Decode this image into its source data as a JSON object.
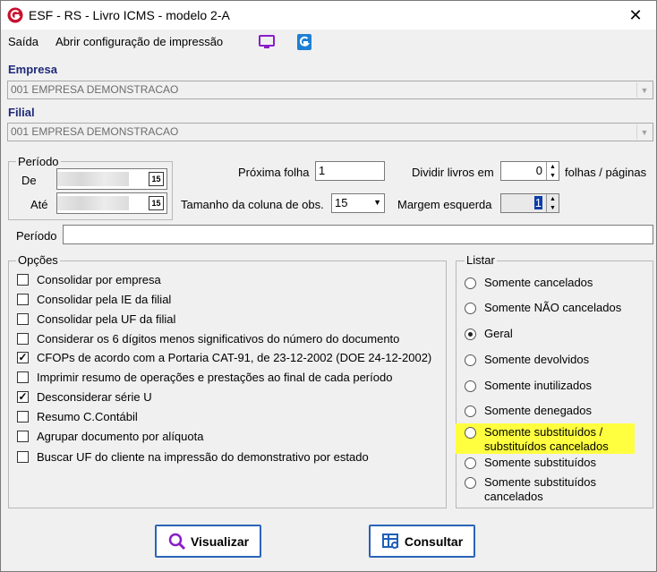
{
  "window": {
    "title": "ESF - RS - Livro ICMS - modelo 2-A",
    "close_glyph": "✕"
  },
  "menu": {
    "exit": "Saída",
    "open_print_config": "Abrir configuração de impressão"
  },
  "company": {
    "label": "Empresa",
    "value": "001 EMPRESA DEMONSTRACAO"
  },
  "branch": {
    "label": "Filial",
    "value": "001 EMPRESA DEMONSTRACAO"
  },
  "period": {
    "group_title": "Período",
    "from_label": "De",
    "to_label": "Até",
    "calendar_glyph": "15"
  },
  "fields": {
    "next_sheet_label": "Próxima folha",
    "next_sheet_value": "1",
    "split_books_label": "Dividir livros em",
    "split_books_value": "0",
    "split_books_suffix": "folhas / páginas",
    "obs_col_label": "Tamanho da coluna de obs.",
    "obs_col_value": "15",
    "left_margin_label": "Margem esquerda",
    "left_margin_value": "1",
    "period_text_label": "Período",
    "period_text_value": ""
  },
  "options": {
    "group_title": "Opções",
    "items": [
      {
        "label": "Consolidar por empresa",
        "checked": false
      },
      {
        "label": "Consolidar pela IE da filial",
        "checked": false
      },
      {
        "label": "Consolidar pela UF da filial",
        "checked": false
      },
      {
        "label": "Considerar os 6 dígitos menos significativos do número do documento",
        "checked": false
      },
      {
        "label": "CFOPs de acordo com a Portaria CAT-91, de 23-12-2002 (DOE 24-12-2002)",
        "checked": true
      },
      {
        "label": "Imprimir resumo de operações e prestações ao final de cada período",
        "checked": false
      },
      {
        "label": "Desconsiderar série U",
        "checked": true
      },
      {
        "label": "Resumo C.Contábil",
        "checked": false
      },
      {
        "label": "Agrupar documento por alíquota",
        "checked": false
      },
      {
        "label": "Buscar UF do cliente na impressão do demonstrativo por estado",
        "checked": false
      }
    ]
  },
  "list": {
    "group_title": "Listar",
    "items": [
      {
        "line1": "Somente cancelados",
        "line2": "",
        "selected": false
      },
      {
        "line1": "Somente NÃO cancelados",
        "line2": "",
        "selected": false
      },
      {
        "line1": "Geral",
        "line2": "",
        "selected": true
      },
      {
        "line1": "Somente devolvidos",
        "line2": "",
        "selected": false
      },
      {
        "line1": "Somente inutilizados",
        "line2": "",
        "selected": false
      },
      {
        "line1": "Somente denegados",
        "line2": "",
        "selected": false
      },
      {
        "line1": "Somente substituídos /",
        "line2": "substituídos cancelados",
        "selected": false
      },
      {
        "line1": "Somente substituídos",
        "line2": "",
        "selected": false
      },
      {
        "line1": "Somente substituídos",
        "line2": "cancelados",
        "selected": false
      }
    ]
  },
  "buttons": {
    "view": "Visualizar",
    "query": "Consultar"
  },
  "colors": {
    "accent": "#1f2a7a",
    "highlight": "#ffff40",
    "button_border": "#2a63b8",
    "app_icon": "#c8102e"
  }
}
